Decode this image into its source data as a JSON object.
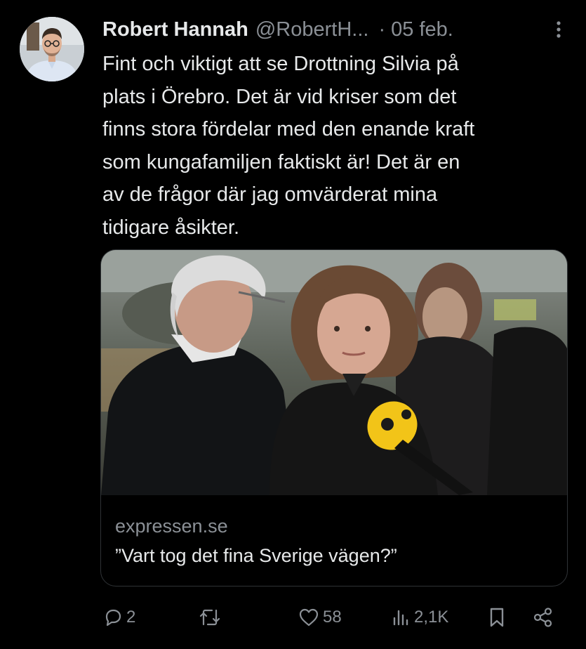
{
  "tweet": {
    "author": {
      "name": "Robert Hannah",
      "handle": "@RobertH...",
      "avatar_icon": "profile-photo"
    },
    "date": "· 05 feb.",
    "more_icon": "more-vertical-icon",
    "text": "Fint och viktigt att se Drottning Silvia på\nplats i Örebro. Det är vid kriser som det\nfinns stora fördelar med den enande kraft\nsom kungafamiljen faktiskt är! Det är en\nav de frågor där jag omvärderat mina\ntidigare åsikter.",
    "card": {
      "image_icon": "news-photo",
      "domain": "expressen.se",
      "title": "”Vart tog det fina Sverige vägen?”"
    },
    "actions": {
      "replies": "2",
      "retweets": "",
      "likes": "58",
      "views": "2,1K"
    },
    "colors": {
      "background": "#000000",
      "text": "#e7e9ea",
      "secondary": "#8b9096",
      "border": "#2f3336"
    }
  }
}
